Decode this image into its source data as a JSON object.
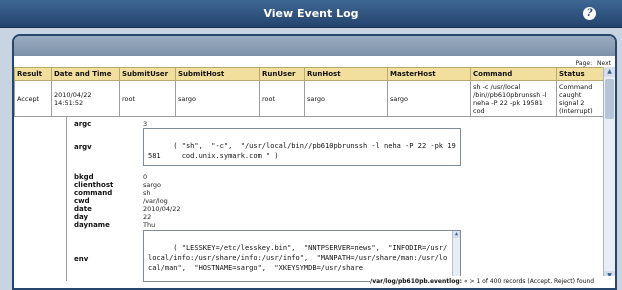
{
  "window": {
    "title": "View Event Log",
    "help_icon": "help-icon"
  },
  "pager": {
    "label": "Page:",
    "next": "Next"
  },
  "table": {
    "columns": [
      "Result",
      "Date and Time",
      "SubmitUser",
      "SubmitHost",
      "RunUser",
      "RunHost",
      "MasterHost",
      "Command",
      "Status"
    ],
    "row": {
      "result": "Accept",
      "datetime": "2010/04/22 14:51:52",
      "submituser": "root",
      "submithost": "sargo",
      "runuser": "root",
      "runhost": "sargo",
      "masterhost": "sargo",
      "command": "sh -c /usr/local /bin//pb610pbrunssh -l neha -P 22 -pk 19581 cod",
      "status": "Command caught signal 2 (Interrupt)"
    }
  },
  "details": {
    "argc_label": "argc",
    "argc_value": "3",
    "argv_label": "argv",
    "argv_value": "( \"sh\",  \"-c\",  \"/usr/local/bin//pb610pbrunssh -l neha -P 22 -pk 19581     cod.unix.symark.com \" )",
    "bkgd_label": "bkgd",
    "bkgd_value": "0",
    "clienthost_label": "clienthost",
    "clienthost_value": "sargo",
    "command_label": "command",
    "command_value": "sh",
    "cwd_label": "cwd",
    "cwd_value": "/var/log",
    "date_label": "date",
    "date_value": "2010/04/22",
    "day_label": "day",
    "day_value": "22",
    "dayname_label": "dayname",
    "dayname_value": "Thu",
    "env_label": "env",
    "env_value": "( \"LESSKEY=/etc/lesskey.bin\",  \"NNTPSERVER=news\",  \"INFODIR=/usr/local/info:/usr/share/info:/usr/info\",  \"MANPATH=/usr/share/man:/usr/local/man\",  \"HOSTNAME=sargo\",  \"XKEYSYMDB=/usr/share"
  },
  "status_bar": {
    "logfile": "/var/log/pb610pb.eventlog:",
    "summary": "« > 1 of 400 records (Accept, Reject) found"
  }
}
